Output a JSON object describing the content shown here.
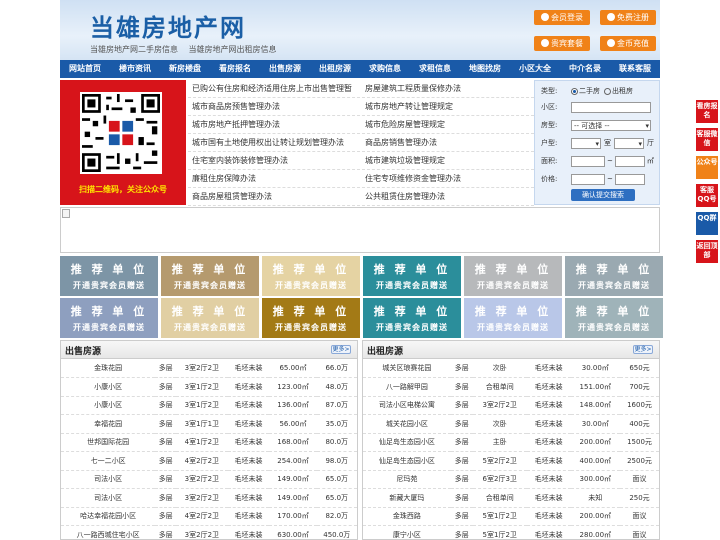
{
  "header": {
    "logo": "当雄房地产网",
    "slogan": [
      "当雄房地产网二手房信息",
      "当雄房地产网出租房信息"
    ],
    "buttons": [
      "会员登录",
      "免费注册",
      "贵宾套餐",
      "金币充值"
    ]
  },
  "nav": [
    "网站首页",
    "楼市资讯",
    "新房楼盘",
    "看房报名",
    "出售房源",
    "出租房源",
    "求购信息",
    "求租信息",
    "地图找房",
    "小区大全",
    "中介名录",
    "联系客服"
  ],
  "qr": {
    "caption": "扫描二维码，关注公众号"
  },
  "news": [
    [
      "已购公有住房和经济适用住房上市出售管理暂",
      "房屋建筑工程质量保修办法"
    ],
    [
      "城市商品房预售管理办法",
      "城市房地产转让管理规定"
    ],
    [
      "城市房地产抵押管理办法",
      "城市危险房屋管理规定"
    ],
    [
      "城市国有土地使用权出让转让规划管理办法",
      "商品房销售管理办法"
    ],
    [
      "住宅室内装饰装修管理办法",
      "城市建筑垃圾管理规定"
    ],
    [
      "廉租住房保障办法",
      "住宅专项维修资金管理办法"
    ],
    [
      "商品房屋租赁管理办法",
      "公共租赁住房管理办法"
    ]
  ],
  "search": {
    "type_label": "类型:",
    "opt_sale": "二手房",
    "opt_rent": "出租房",
    "community_label": "小区:",
    "house_type_label": "房型:",
    "house_type_value": "-- 可选择 --",
    "layout_label": "户型:",
    "room_unit": "室",
    "hall_unit": "厅",
    "area_label": "面积:",
    "price_label": "价格:",
    "tilde": "~",
    "submit": "确认提交搜索"
  },
  "ads": {
    "title": "推 荐 单 位",
    "sub": "开通贵宾会员赠送"
  },
  "sale": {
    "title": "出售房源",
    "more": "更多>",
    "rows": [
      [
        "金珠花园",
        "多层",
        "3室2厅2卫",
        "毛坯未装",
        "65.00㎡",
        "66.0万"
      ],
      [
        "小康小区",
        "多层",
        "3室1厅2卫",
        "毛坯未装",
        "123.00㎡",
        "48.0万"
      ],
      [
        "小康小区",
        "多层",
        "3室1厅2卫",
        "毛坯未装",
        "136.00㎡",
        "87.0万"
      ],
      [
        "幸福花园",
        "多层",
        "3室1厅1卫",
        "毛坯未装",
        "56.00㎡",
        "35.0万"
      ],
      [
        "世邦国际花园",
        "多层",
        "4室1厅2卫",
        "毛坯未装",
        "168.00㎡",
        "80.0万"
      ],
      [
        "七一二小区",
        "多层",
        "4室2厅2卫",
        "毛坯未装",
        "254.00㎡",
        "98.0万"
      ],
      [
        "司法小区",
        "多层",
        "3室2厅2卫",
        "毛坯未装",
        "149.00㎡",
        "65.0万"
      ],
      [
        "司法小区",
        "多层",
        "3室2厅2卫",
        "毛坯未装",
        "149.00㎡",
        "65.0万"
      ],
      [
        "哈达幸福花园小区",
        "多层",
        "4室2厅2卫",
        "毛坯未装",
        "170.00㎡",
        "82.0万"
      ],
      [
        "八一路西城住宅小区",
        "多层",
        "3室2厅2卫",
        "毛坯未装",
        "630.00㎡",
        "450.0万"
      ]
    ]
  },
  "rent": {
    "title": "出租房源",
    "more": "更多>",
    "rows": [
      [
        "城关区琅赛花园",
        "多层",
        "次卧",
        "毛坯未装",
        "30.00㎡",
        "650元"
      ],
      [
        "八一路解甲园",
        "多层",
        "合租单间",
        "毛坯未装",
        "151.00㎡",
        "700元"
      ],
      [
        "司法小区电梯公寓",
        "多层",
        "3室2厅2卫",
        "毛坯未装",
        "148.00㎡",
        "1600元"
      ],
      [
        "城关花园小区",
        "多层",
        "次卧",
        "毛坯未装",
        "30.00㎡",
        "400元"
      ],
      [
        "仙足岛生态园小区",
        "多层",
        "主卧",
        "毛坯未装",
        "200.00㎡",
        "1500元"
      ],
      [
        "仙足岛生态园小区",
        "多层",
        "5室2厅2卫",
        "毛坯未装",
        "400.00㎡",
        "2500元"
      ],
      [
        "尼玛苑",
        "多层",
        "6室2厅3卫",
        "毛坯未装",
        "300.00㎡",
        "面议"
      ],
      [
        "新藏大厦玛",
        "多层",
        "合租单间",
        "毛坯未装",
        "未知",
        "250元"
      ],
      [
        "金珠西路",
        "多层",
        "5室1厅2卫",
        "毛坯未装",
        "200.00㎡",
        "面议"
      ],
      [
        "康宁小区",
        "多层",
        "5室1厅2卫",
        "毛坯未装",
        "280.00㎡",
        "面议"
      ]
    ]
  },
  "float": [
    "看房报名",
    "客服微信",
    "公众号",
    "客服QQ号",
    "QQ群",
    "返回顶部"
  ],
  "colors": {
    "nav": "#1a5aa8",
    "accent": "#f08218",
    "qr_bg": "#d7141a"
  }
}
